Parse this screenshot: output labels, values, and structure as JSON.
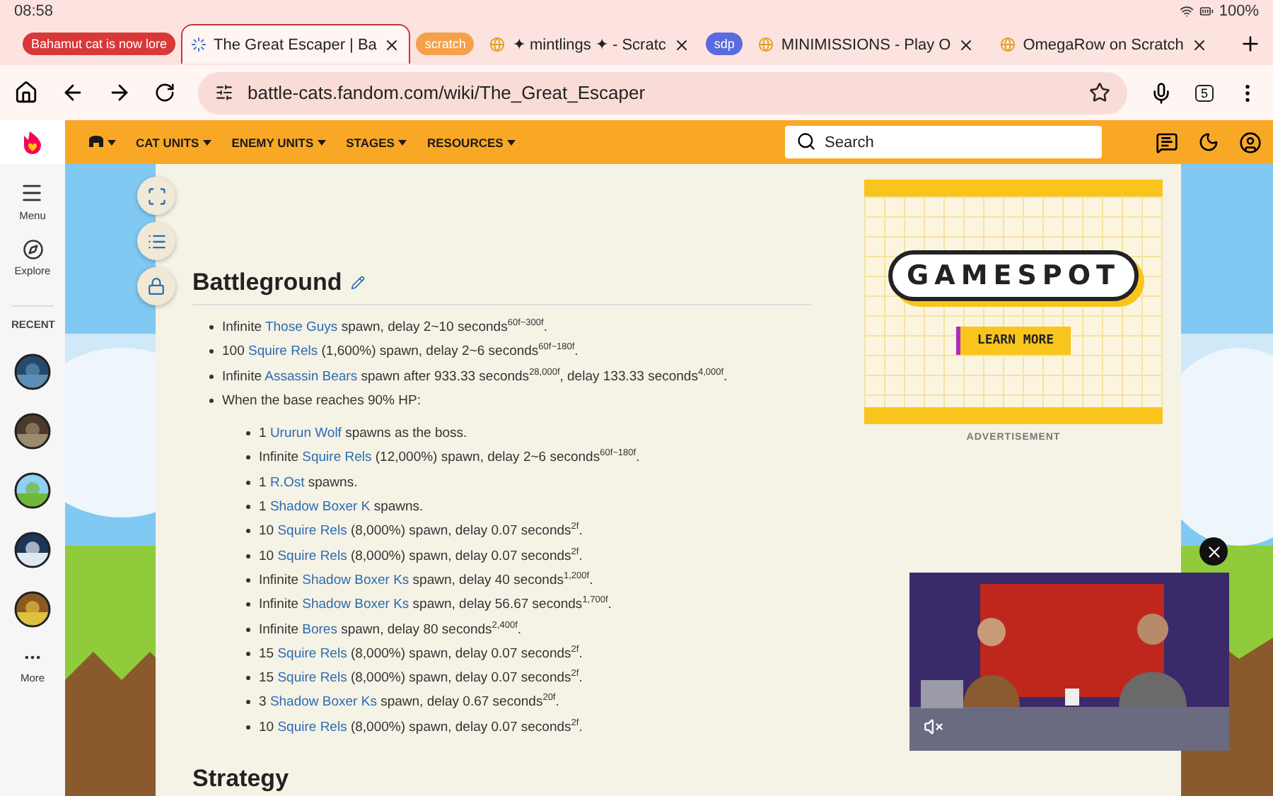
{
  "status_bar": {
    "time": "08:58",
    "battery": "100%"
  },
  "tabs": [
    {
      "kind": "group",
      "label": "Bahamut cat is now lore",
      "color": "#d93838"
    },
    {
      "kind": "tab",
      "label": "The Great Escaper | Ba",
      "loading": true,
      "selected": true
    },
    {
      "kind": "group",
      "label": "scratch",
      "color": "#f5a04a"
    },
    {
      "kind": "tab",
      "label": "✦ mintlings ✦ - Scratc",
      "loading": false,
      "selected": false
    },
    {
      "kind": "group",
      "label": "sdp",
      "color": "#5a6be0"
    },
    {
      "kind": "tab",
      "label": "MINIMISSIONS - Play O",
      "loading": false,
      "selected": false
    },
    {
      "kind": "tab",
      "label": "OmegaRow on Scratch",
      "loading": false,
      "selected": false
    }
  ],
  "address_bar": {
    "url": "battle-cats.fandom.com/wiki/The_Great_Escaper",
    "tab_count": "5"
  },
  "rail": {
    "items": [
      {
        "kind": "menu",
        "label": "Menu"
      },
      {
        "kind": "explore",
        "label": "Explore"
      }
    ],
    "recent_heading": "RECENT",
    "recent": [
      {
        "kind": "picture"
      },
      {
        "kind": "picture"
      },
      {
        "kind": "picture"
      },
      {
        "kind": "picture"
      },
      {
        "kind": "picture"
      }
    ],
    "more": "More"
  },
  "nav": {
    "items": [
      "CAT UNITS",
      "ENEMY UNITS",
      "STAGES",
      "RESOURCES"
    ],
    "search": {
      "placeholder": "Search"
    }
  },
  "article": {
    "heading": "Battleground",
    "items": [
      {
        "pre": "Infinite ",
        "link": "Those Guys",
        "post": " spawn, delay 2~10 seconds$^{60f~300f}$."
      },
      {
        "pre": "100 ",
        "link": "Squire Rels",
        "post": " (1,600%) spawn, delay 2~6 seconds$^{60f~180f}$."
      },
      {
        "pre": "Infinite ",
        "link": "Assassin Bears",
        "post": " spawn after 933.33 seconds$^{28,000f}$, delay 133.33 seconds$^{4,000f}$."
      },
      {
        "pre": "When the base reaches 90% HP:",
        "children": [
          {
            "pre": "1 ",
            "link": "Ururun Wolf",
            "post": " spawns as the boss."
          },
          {
            "pre": "Infinite ",
            "link": "Squire Rels",
            "post": " (12,000%) spawn, delay 2~6 seconds$^{60f~180f}$."
          },
          {
            "pre": "1 ",
            "link": "R.Ost",
            "post": " spawns."
          },
          {
            "pre": "1 ",
            "link": "Shadow Boxer K",
            "post": " spawns."
          },
          {
            "pre": "10 ",
            "link": "Squire Rels",
            "post": " (8,000%) spawn, delay 0.07 seconds$^{2f}$."
          },
          {
            "pre": "10 ",
            "link": "Squire Rels",
            "post": " (8,000%) spawn, delay 0.07 seconds$^{2f}$."
          },
          {
            "pre": "Infinite ",
            "link": "Shadow Boxer Ks",
            "post": " spawn, delay 40 seconds$^{1,200f}$."
          },
          {
            "pre": "Infinite ",
            "link": "Shadow Boxer Ks",
            "post": " spawn, delay 56.67 seconds$^{1,700f}$."
          },
          {
            "pre": "Infinite ",
            "link": "Bores",
            "post": " spawn, delay 80 seconds$^{2,400f}$."
          },
          {
            "pre": "15 ",
            "link": "Squire Rels",
            "post": " (8,000%) spawn, delay 0.07 seconds$^{2f}$."
          },
          {
            "pre": "15 ",
            "link": "Squire Rels",
            "post": " (8,000%) spawn, delay 0.07 seconds$^{2f}$."
          },
          {
            "pre": "3 ",
            "link": "Shadow Boxer Ks",
            "post": " spawn, delay 0.67 seconds$^{20f}$."
          },
          {
            "pre": "10 ",
            "link": "Squire Rels",
            "post": " (8,000%) spawn, delay 0.07 seconds$^{2f}$."
          }
        ]
      }
    ],
    "next_heading": "Strategy"
  },
  "ad": {
    "brand": "GAMESPOT",
    "button": "LEARN MORE",
    "caption": "ADVERTISEMENT"
  },
  "video": {
    "kind": "picture",
    "muted": true
  }
}
